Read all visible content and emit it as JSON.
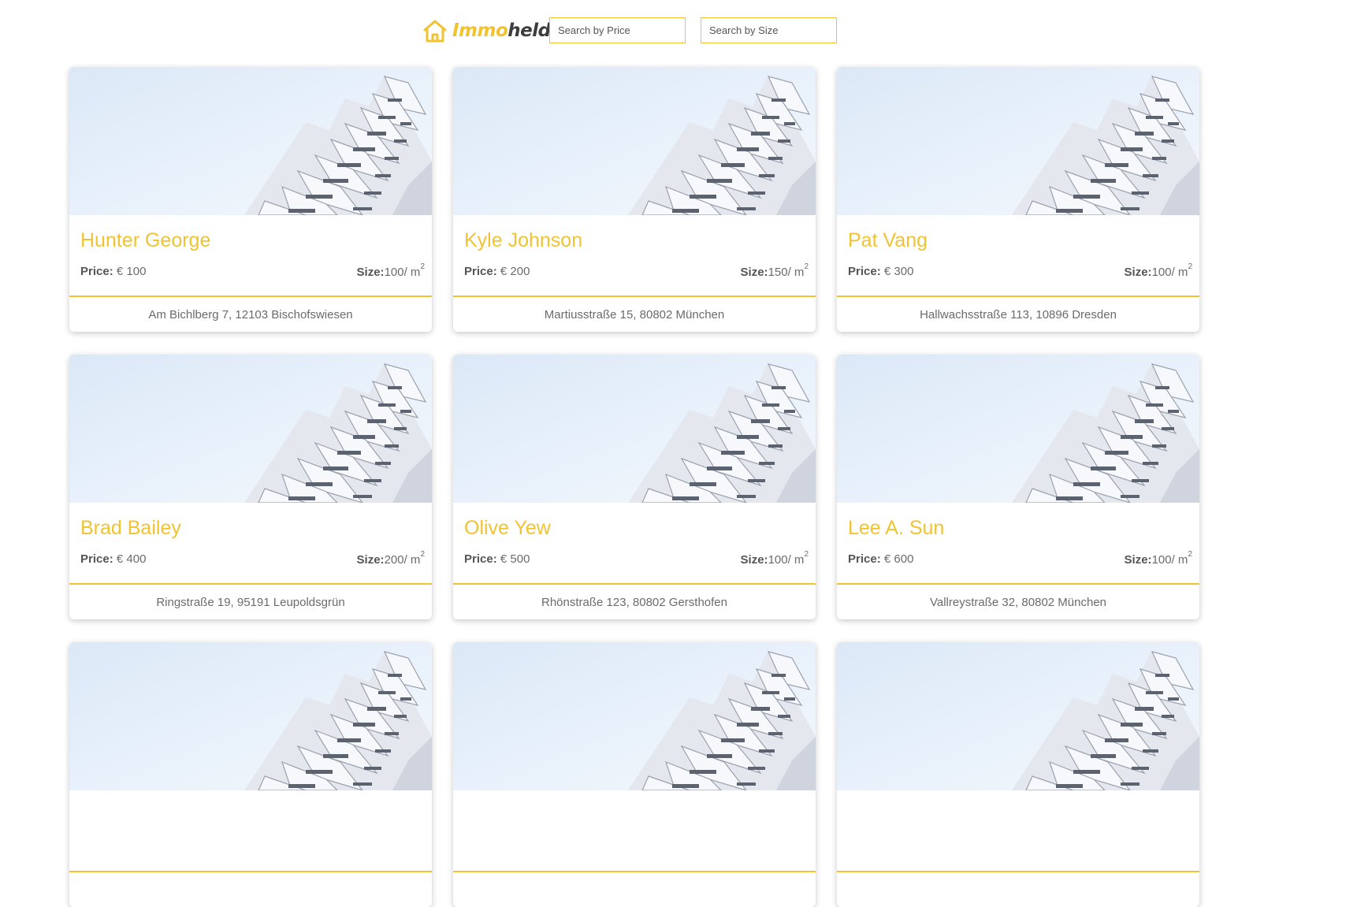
{
  "header": {
    "brand_part1": "Immo",
    "brand_part2": "held",
    "brand_color": "#f1c332",
    "search_price_placeholder": "Search by Price",
    "search_size_placeholder": "Search by Size"
  },
  "listing_labels": {
    "price_label": "Price:",
    "size_label": "Size:",
    "size_unit": "/ m",
    "size_exponent": "2"
  },
  "listings": [
    {
      "name": "Hunter George",
      "price": "€ 100",
      "size": "100",
      "address": "Am Bichlberg 7, 12103 Bischofswiesen"
    },
    {
      "name": "Kyle Johnson",
      "price": "€ 200",
      "size": "150",
      "address": "Martiusstraße 15, 80802 München"
    },
    {
      "name": "Pat Vang",
      "price": "€ 300",
      "size": "100",
      "address": "Hallwachsstraße 113, 10896 Dresden"
    },
    {
      "name": "Brad Bailey",
      "price": "€ 400",
      "size": "200",
      "address": "Ringstraße 19, 95191 Leupoldsgrün"
    },
    {
      "name": "Olive Yew",
      "price": "€ 500",
      "size": "100",
      "address": "Rhönstraße 123, 80802 Gersthofen"
    },
    {
      "name": "Lee A. Sun",
      "price": "€ 600",
      "size": "100",
      "address": "Vallreystraße 32, 80802 München"
    },
    {
      "name": "",
      "price": "",
      "size": "",
      "address": ""
    },
    {
      "name": "",
      "price": "",
      "size": "",
      "address": ""
    },
    {
      "name": "",
      "price": "",
      "size": "",
      "address": ""
    }
  ]
}
